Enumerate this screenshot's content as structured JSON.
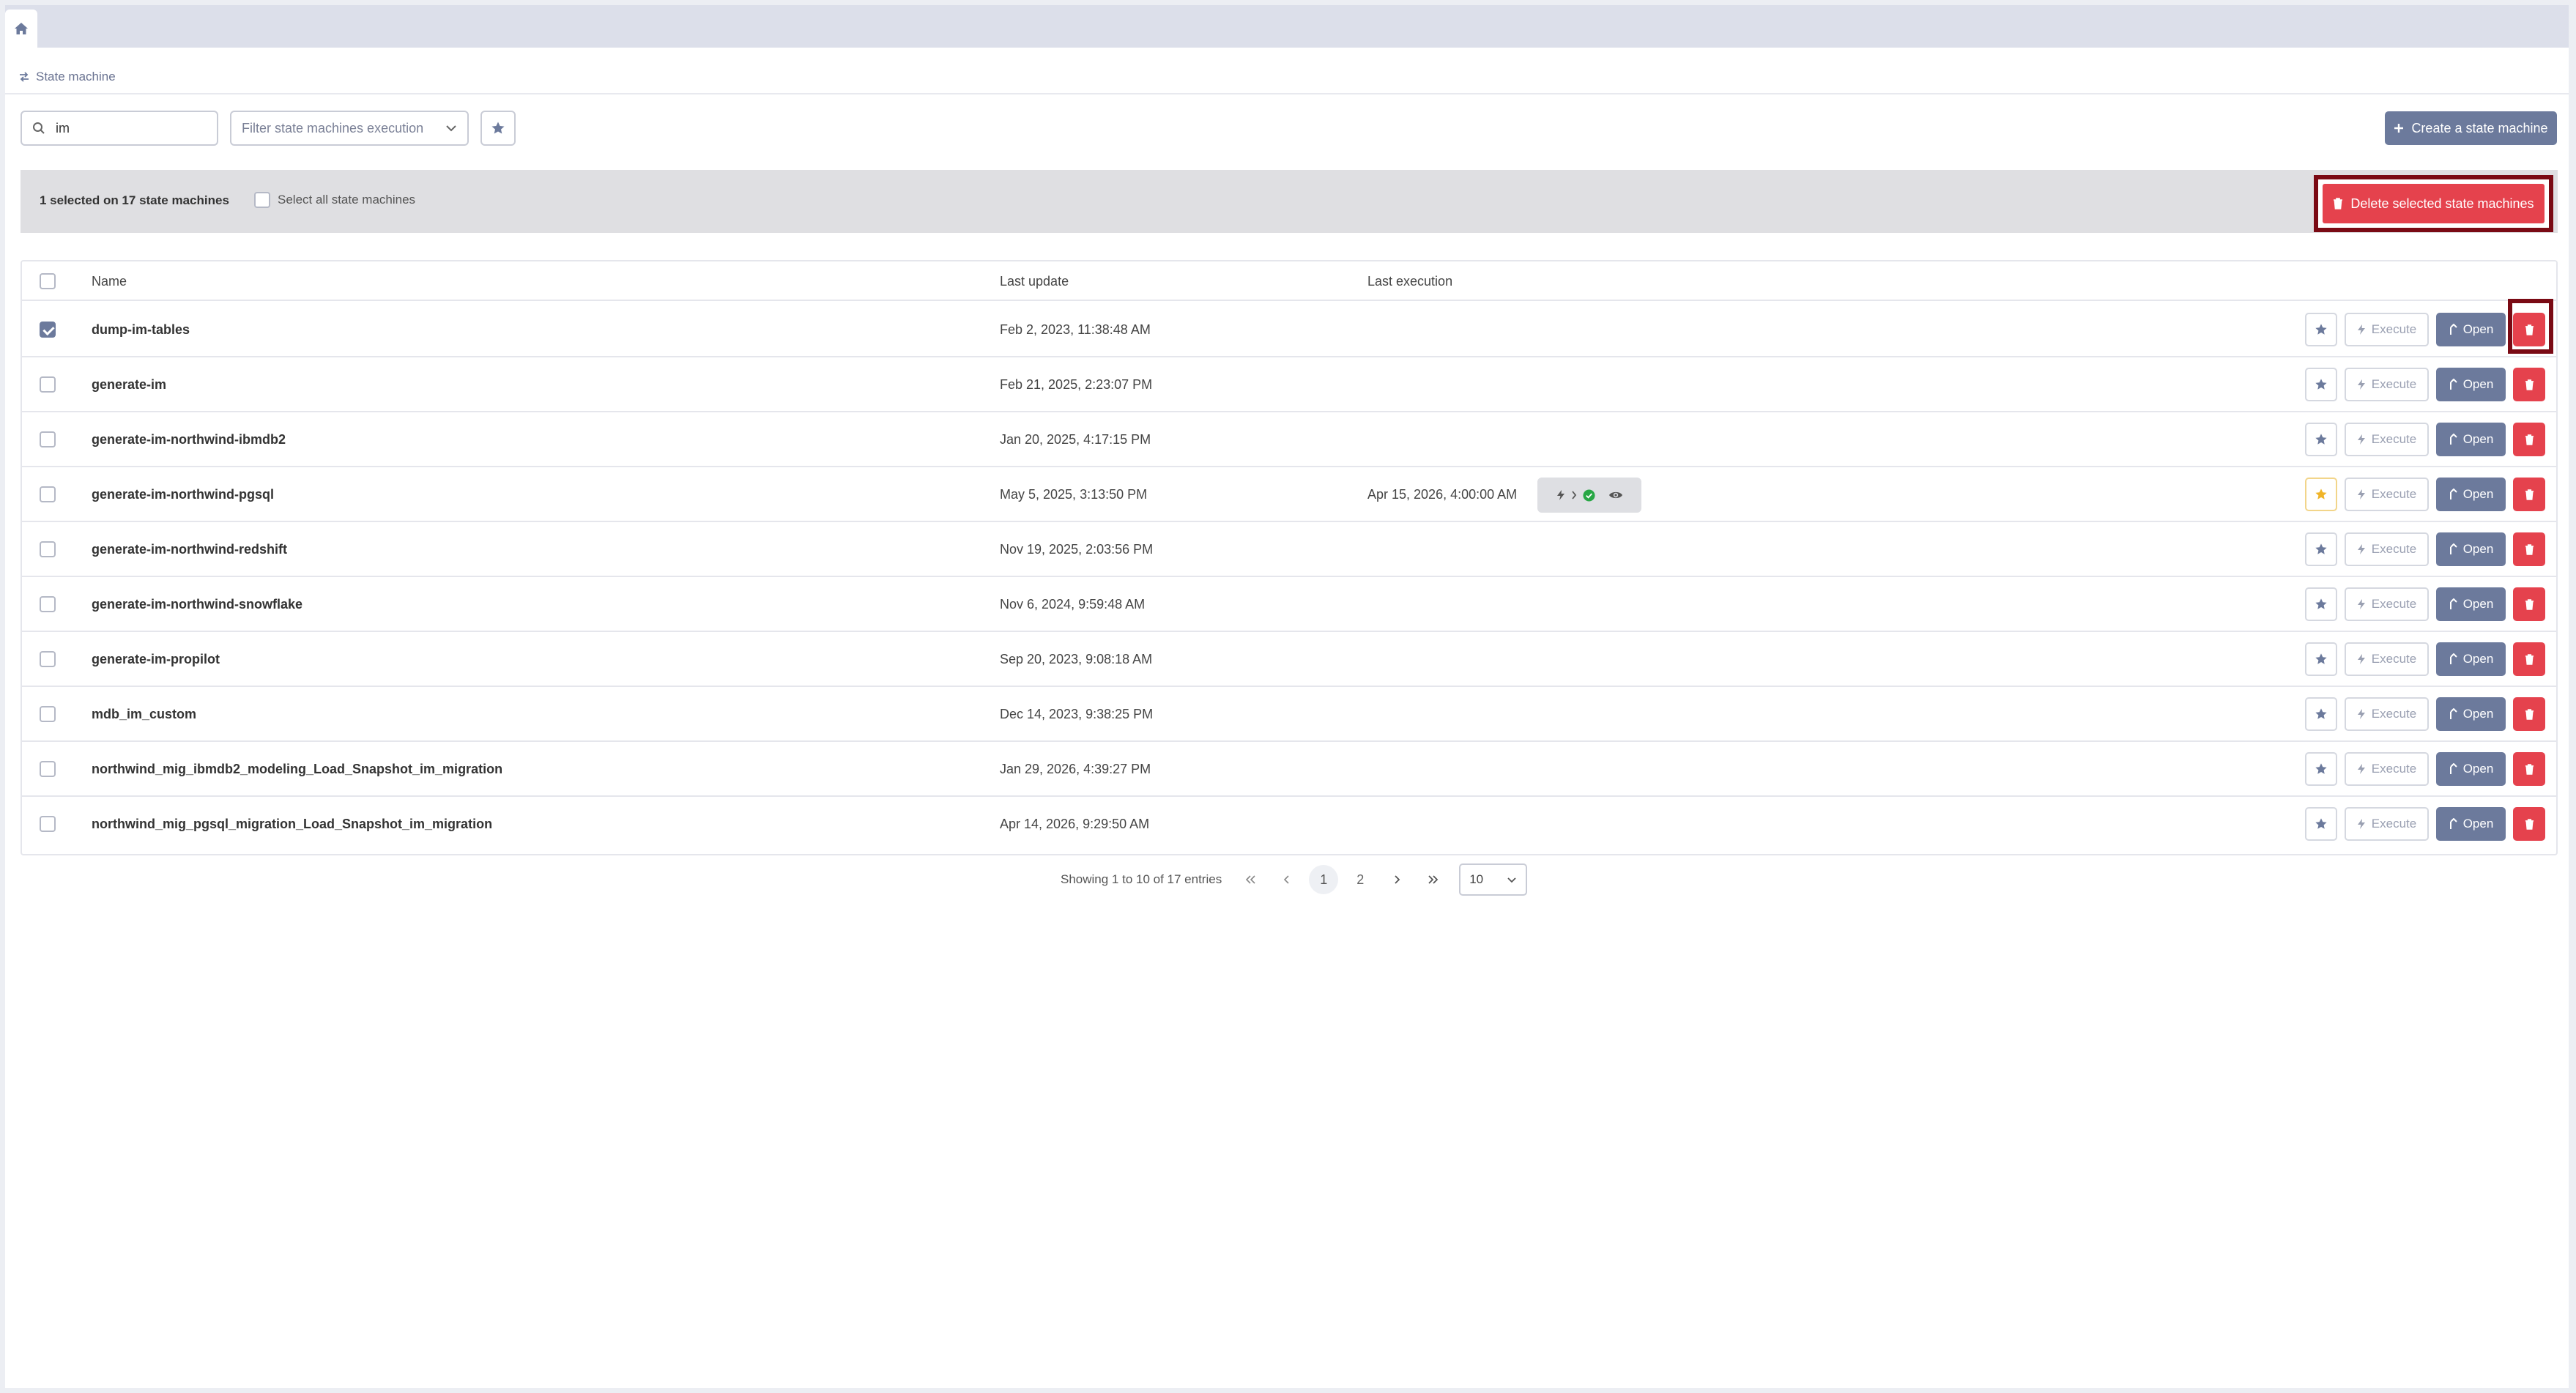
{
  "breadcrumb": {
    "label": "State machine"
  },
  "toolbar": {
    "search_value": "im",
    "filter_placeholder": "Filter state machines execution",
    "create_label": "Create a state machine"
  },
  "selection": {
    "summary": "1 selected on 17 state machines",
    "select_all_label": "Select all state machines",
    "delete_label": "Delete selected state machines"
  },
  "table": {
    "headers": {
      "name": "Name",
      "last_update": "Last update",
      "last_execution": "Last execution"
    },
    "execute_label": "Execute",
    "open_label": "Open",
    "rows": [
      {
        "name": "dump-im-tables",
        "last_update": "Feb 2, 2023, 11:38:48 AM",
        "last_execution": "",
        "checked": true,
        "favorite": false
      },
      {
        "name": "generate-im",
        "last_update": "Feb 21, 2025, 2:23:07 PM",
        "last_execution": "",
        "checked": false,
        "favorite": false
      },
      {
        "name": "generate-im-northwind-ibmdb2",
        "last_update": "Jan 20, 2025, 4:17:15 PM",
        "last_execution": "",
        "checked": false,
        "favorite": false
      },
      {
        "name": "generate-im-northwind-pgsql",
        "last_update": "May 5, 2025, 3:13:50 PM",
        "last_execution": "Apr 15, 2026, 4:00:00 AM",
        "checked": false,
        "favorite": true
      },
      {
        "name": "generate-im-northwind-redshift",
        "last_update": "Nov 19, 2025, 2:03:56 PM",
        "last_execution": "",
        "checked": false,
        "favorite": false
      },
      {
        "name": "generate-im-northwind-snowflake",
        "last_update": "Nov 6, 2024, 9:59:48 AM",
        "last_execution": "",
        "checked": false,
        "favorite": false
      },
      {
        "name": "generate-im-propilot",
        "last_update": "Sep 20, 2023, 9:08:18 AM",
        "last_execution": "",
        "checked": false,
        "favorite": false
      },
      {
        "name": "mdb_im_custom",
        "last_update": "Dec 14, 2023, 9:38:25 PM",
        "last_execution": "",
        "checked": false,
        "favorite": false
      },
      {
        "name": "northwind_mig_ibmdb2_modeling_Load_Snapshot_im_migration",
        "last_update": "Jan 29, 2026, 4:39:27 PM",
        "last_execution": "",
        "checked": false,
        "favorite": false
      },
      {
        "name": "northwind_mig_pgsql_migration_Load_Snapshot_im_migration",
        "last_update": "Apr 14, 2026, 9:29:50 AM",
        "last_execution": "",
        "checked": false,
        "favorite": false
      }
    ]
  },
  "pagination": {
    "info": "Showing 1 to 10 of 17 entries",
    "pages": [
      "1",
      "2"
    ],
    "current": "1",
    "page_size": "10"
  },
  "colors": {
    "primary": "#6c7a9c",
    "danger": "#e5424d",
    "highlight_outline": "#7a0a14",
    "favorite": "#f0b429",
    "success": "#28a745"
  }
}
